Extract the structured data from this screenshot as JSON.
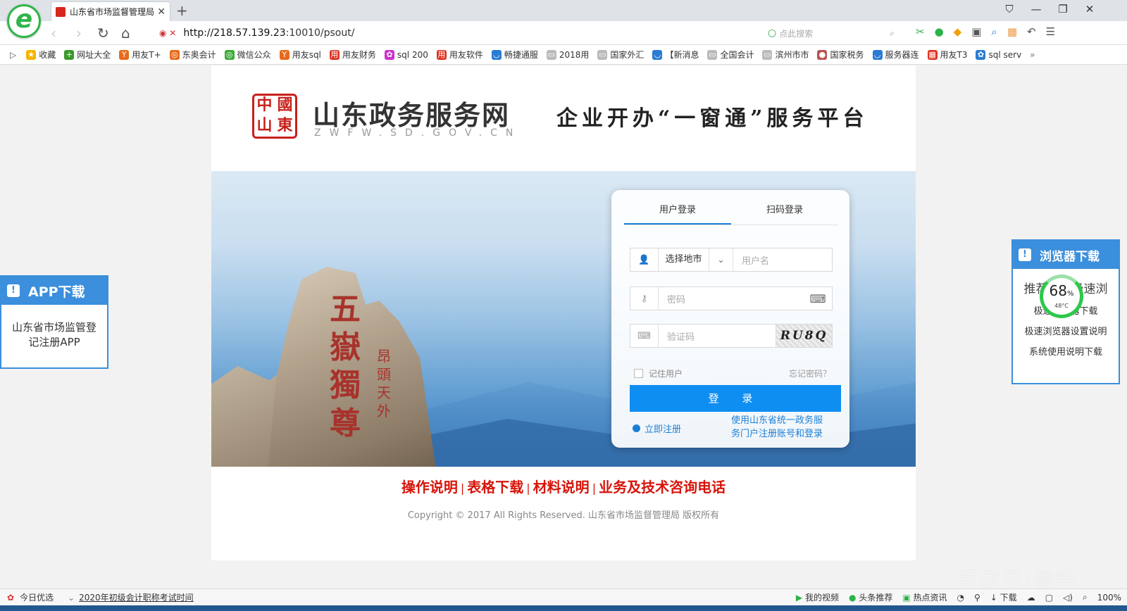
{
  "browser": {
    "tab_title": "山东省市场监督管理局",
    "url_host": "http://218.57.139.23",
    "url_rest": ":10010/psout/",
    "search_placeholder": "点此搜索",
    "zoom": "100%"
  },
  "favorites": [
    {
      "label": "收藏",
      "color": "#f5b400",
      "glyph": "★"
    },
    {
      "label": "网址大全",
      "color": "#3a9a2a",
      "glyph": "+"
    },
    {
      "label": "用友T+",
      "color": "#e86a1a",
      "glyph": "Y"
    },
    {
      "label": "东奥会计",
      "color": "#e86a1a",
      "glyph": "◎"
    },
    {
      "label": "微信公众",
      "color": "#3aaa35",
      "glyph": "◎"
    },
    {
      "label": "用友sql",
      "color": "#e86a1a",
      "glyph": "Y"
    },
    {
      "label": "用友财务",
      "color": "#d32",
      "glyph": "用"
    },
    {
      "label": "sql 200",
      "color": "#c3c",
      "glyph": "✿"
    },
    {
      "label": "用友软件",
      "color": "#d32",
      "glyph": "用"
    },
    {
      "label": "畅捷通服",
      "color": "#2a7bd4",
      "glyph": "◡"
    },
    {
      "label": "2018用",
      "color": "#bbb",
      "glyph": "▭"
    },
    {
      "label": "国家外汇",
      "color": "#bbb",
      "glyph": "▭"
    },
    {
      "label": "【新消息",
      "color": "#2a7bd4",
      "glyph": "◡"
    },
    {
      "label": "全国会计",
      "color": "#bbb",
      "glyph": "▭"
    },
    {
      "label": "滨州市市",
      "color": "#bbb",
      "glyph": "▭"
    },
    {
      "label": "国家税务",
      "color": "#b55",
      "glyph": "●"
    },
    {
      "label": "服务器连",
      "color": "#2a7bd4",
      "glyph": "◡"
    },
    {
      "label": "用友T3",
      "color": "#d32",
      "glyph": "▦"
    },
    {
      "label": "sql serv",
      "color": "#2a7bd4",
      "glyph": "✿"
    }
  ],
  "header": {
    "seal_chars": [
      "中",
      "國",
      "山",
      "東"
    ],
    "brand_cn": "山东政务服务网",
    "brand_en": "ZWFW.SD.GOV.CN",
    "slogan": "企业开办“一窗通”服务平台"
  },
  "banner": {
    "carving_main": "五嶽獨尊",
    "carving_side": "昂頭天外"
  },
  "login": {
    "tab_user": "用户登录",
    "tab_scan": "扫码登录",
    "city_select": "选择地市",
    "username_placeholder": "用户名",
    "password_placeholder": "密码",
    "captcha_placeholder": "验证码",
    "captcha_text": "RU8Q",
    "remember": "记住用户",
    "forgot": "忘记密码？",
    "submit": "登 录",
    "register": "立即注册",
    "unified_login": "使用山东省统一政务服务门户注册账号和登录"
  },
  "footer": {
    "links": [
      "操作说明",
      "表格下载",
      "材料说明",
      "业务及技术咨询电话"
    ],
    "copyright": "Copyright © 2017 All Rights Reserved. 山东省市场监督管理局 版权所有"
  },
  "app_widget": {
    "title": "APP下载",
    "body": "山东省市场监管登记注册APP"
  },
  "browser_widget": {
    "title": "浏览器下载",
    "recommend": "推荐使用极速浏",
    "items": [
      "极速浏览器下载",
      "极速浏览器设置说明",
      "系统使用说明下载"
    ]
  },
  "gauge": {
    "percent": "68",
    "unit": "%",
    "temp": "48°C"
  },
  "statusbar": {
    "today": "今日优选",
    "news": "2020年初级会计职称考试时间",
    "video": "我的视频",
    "headline": "头条推荐",
    "hot": "热点资讯",
    "download": "下载",
    "zoom": "100%"
  },
  "watermark": "百家号/傻宗"
}
